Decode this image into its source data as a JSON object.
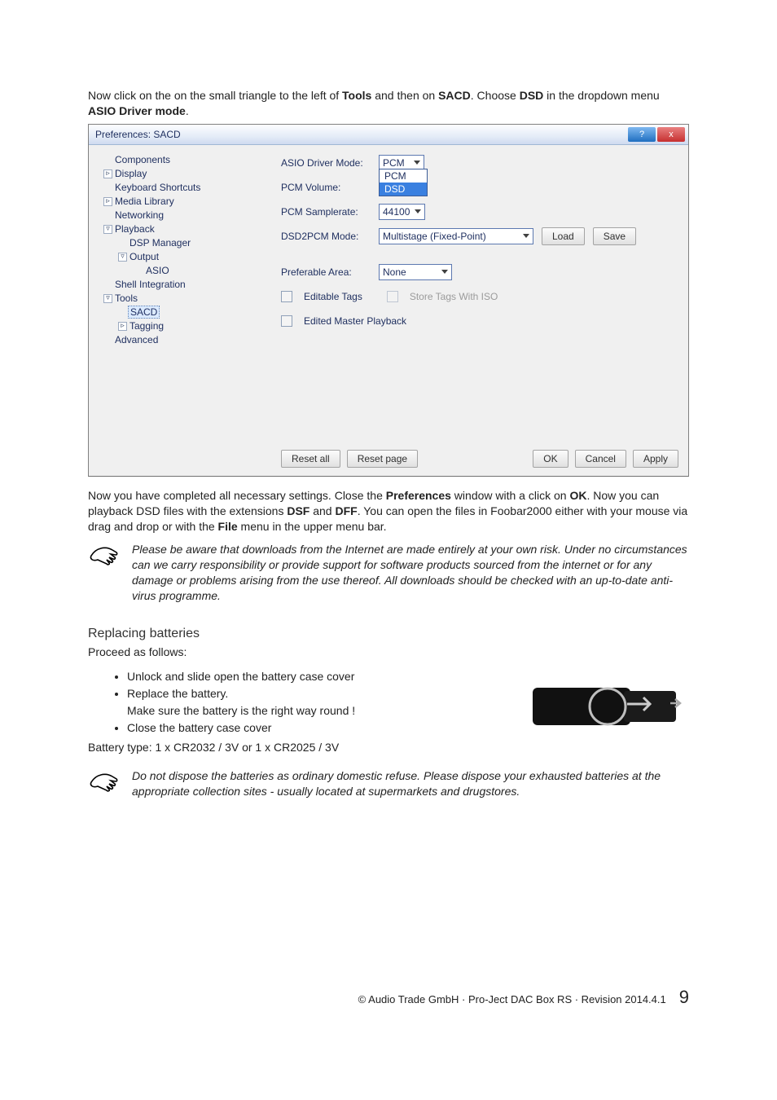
{
  "intro": {
    "line1_a": "Now click on the on the small triangle to the left of ",
    "line1_b": "Tools",
    "line1_c": " and then on ",
    "line1_d": "SACD",
    "line1_e": ". Choose ",
    "line1_f": "DSD",
    "line1_g": " in the dropdown menu ",
    "line1_h": "ASIO Driver mode",
    "line1_i": "."
  },
  "prefs_window": {
    "title": "Preferences: SACD",
    "titlebar_help": "?",
    "titlebar_close": "x",
    "tree": {
      "components": "Components",
      "display": "Display",
      "keyboard": "Keyboard Shortcuts",
      "media": "Media Library",
      "networking": "Networking",
      "playback": "Playback",
      "dsp": "DSP Manager",
      "output": "Output",
      "asio": "ASIO",
      "shell": "Shell Integration",
      "tools": "Tools",
      "sacd": "SACD",
      "tagging": "Tagging",
      "advanced": "Advanced"
    },
    "form": {
      "asio_mode_lbl": "ASIO Driver Mode:",
      "asio_mode_val": "PCM",
      "asio_mode_opts": {
        "pcm": "PCM",
        "dsd": "DSD"
      },
      "pcm_vol_lbl": "PCM Volume:",
      "pcm_rate_lbl": "PCM Samplerate:",
      "pcm_rate_val": "44100",
      "dsd2pcm_lbl": "DSD2PCM Mode:",
      "dsd2pcm_val": "Multistage (Fixed-Point)",
      "load_btn": "Load",
      "save_btn": "Save",
      "pref_area_lbl": "Preferable Area:",
      "pref_area_val": "None",
      "editable_tags": "Editable Tags",
      "store_tags": "Store Tags With ISO",
      "edited_master": "Edited Master Playback"
    },
    "footer": {
      "reset_all": "Reset all",
      "reset_page": "Reset page",
      "ok": "OK",
      "cancel": "Cancel",
      "apply": "Apply"
    }
  },
  "after1": {
    "a": "Now you have completed all necessary settings. Close the ",
    "b": "Preferences",
    "c": " window with a click on ",
    "d": "OK",
    "e": ". Now you can playback DSD files with the extensions ",
    "f": "DSF",
    "g": " and ",
    "h": "DFF",
    "i": ". You can open the files in Foobar2000 either with your mouse via drag and drop or with the ",
    "j": "File",
    "k": " menu in the upper menu bar."
  },
  "note1": "Please be aware that downloads from the Internet are made entirely at your own risk. Under no circumstances can we carry responsibility or provide support for software products sourced from the internet or for any damage or problems arising from the use thereof. All downloads should be checked with an up-to-date anti-virus programme.",
  "batteries": {
    "heading": "Replacing batteries",
    "proceed": "Proceed as follows:",
    "step1": "Unlock and slide open the battery case cover",
    "step2a": "Replace the battery.",
    "step2b": "Make sure the battery is the right way round !",
    "step3": "Close the battery case cover",
    "type": "Battery type: 1 x CR2032 / 3V or 1 x CR2025 / 3V"
  },
  "note2": "Do not dispose the batteries as ordinary domestic refuse. Please dispose your exhausted batteries at the appropriate collection sites - usually located at supermarkets and drugstores.",
  "footer": {
    "copyright": "© Audio Trade GmbH · Pro-Ject DAC Box RS · Revision 2014.4.1",
    "page": "9"
  }
}
